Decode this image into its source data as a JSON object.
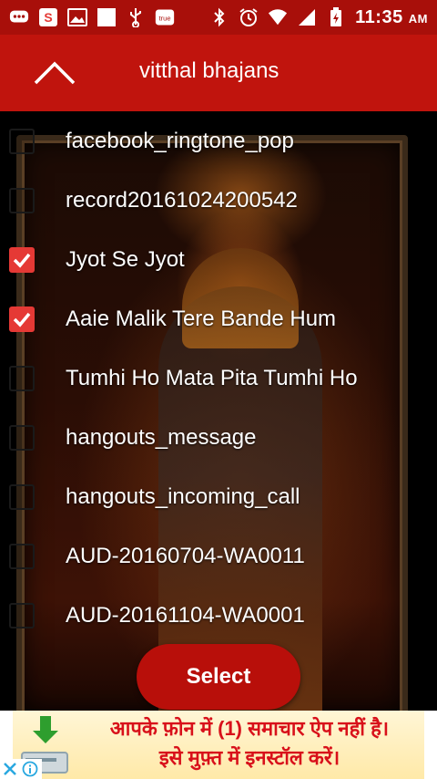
{
  "status_bar": {
    "time": "11:35",
    "ampm": "AM",
    "icons": [
      "messenger-icon",
      "snapdeal-icon",
      "gallery-icon",
      "blank-notification-icon",
      "usb-icon",
      "truecaller-icon",
      "bluetooth-icon",
      "alarm-icon",
      "wifi-icon",
      "signal-icon",
      "battery-icon"
    ],
    "truecaller_text": "true"
  },
  "app_bar": {
    "title": "vitthal bhajans",
    "up_icon": "chevron-up-icon"
  },
  "list": [
    {
      "label": "facebook_ringtone_pop",
      "checked": false
    },
    {
      "label": "record20161024200542",
      "checked": false
    },
    {
      "label": "Jyot Se Jyot",
      "checked": true
    },
    {
      "label": "Aaie Malik Tere Bande Hum",
      "checked": true
    },
    {
      "label": "Tumhi Ho Mata Pita Tumhi Ho",
      "checked": false
    },
    {
      "label": "hangouts_message",
      "checked": false
    },
    {
      "label": "hangouts_incoming_call",
      "checked": false
    },
    {
      "label": "AUD-20160704-WA0011",
      "checked": false
    },
    {
      "label": "AUD-20161104-WA0001",
      "checked": false
    }
  ],
  "select_button": {
    "label": "Select"
  },
  "ad": {
    "line1": "आपके फ़ोन में (1) समाचार ऐप नहीं है।",
    "line2": "इसे मुफ़्त में इनस्टॉल करें।"
  },
  "colors": {
    "status_bar": "#a80f0a",
    "app_bar": "#c0140d",
    "accent": "#e53935",
    "button": "#b80f0a",
    "ad_text": "#d8101a"
  }
}
